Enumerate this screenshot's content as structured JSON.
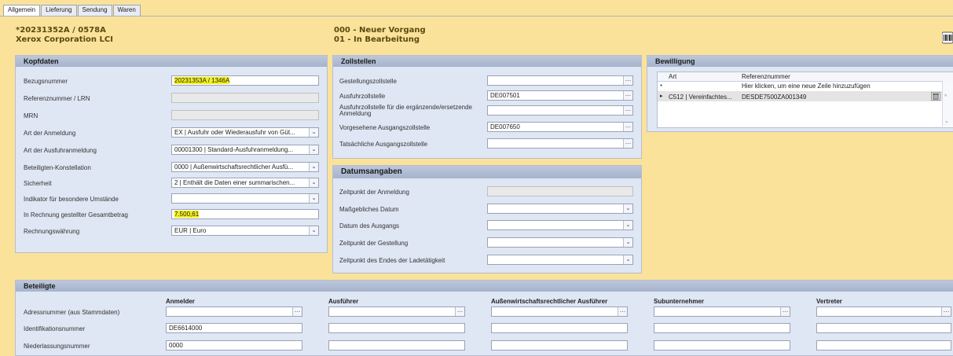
{
  "tabs": [
    "Allgemein",
    "Lieferung",
    "Sendung",
    "Waren"
  ],
  "header": {
    "left_line1": "*20231352A / 0578A",
    "left_line2": "Xerox Corporation LCI",
    "mid_line1": "000 - Neuer Vorgang",
    "mid_line2": "01 - In Bearbeitung"
  },
  "kopfdaten": {
    "title": "Kopfdaten",
    "fields": [
      {
        "label": "Bezugsnummer",
        "value": "20231353A / 1346A"
      },
      {
        "label": "Referenznummer / LRN",
        "value": ""
      },
      {
        "label": "MRN",
        "value": ""
      },
      {
        "label": "Art der Anmeldung",
        "value": "EX | Ausfuhr oder Wiederausfuhr von Güt..."
      },
      {
        "label": "Art der Ausfuhranmeldung",
        "value": "00001300 | Standard-Ausfuhranmeldung..."
      },
      {
        "label": "Beteiligten-Konstellation",
        "value": "0000 | Außenwirtschaftsrechtlicher Ausfü..."
      },
      {
        "label": "Sicherheit",
        "value": "2 | Enthält die Daten einer summarischen..."
      },
      {
        "label": "Indikator für besondere Umstände",
        "value": ""
      },
      {
        "label": "In Rechnung gestellter Gesamtbetrag",
        "value": "7.500,61"
      },
      {
        "label": "Rechnungswährung",
        "value": "EUR | Euro"
      }
    ]
  },
  "zollstellen": {
    "title": "Zollstellen",
    "fields": [
      {
        "label": "Gestellungszollstelle",
        "value": ""
      },
      {
        "label": "Ausfuhrzollstelle",
        "value": "DE007501"
      },
      {
        "label": "Ausfuhrzollstelle für die ergänzende/ersetzende Anmeldung",
        "value": ""
      },
      {
        "label": "Vorgesehene Ausgangszollstelle",
        "value": "DE007650"
      },
      {
        "label": "Tatsächliche Ausgangszollstelle",
        "value": ""
      }
    ]
  },
  "datumsangaben": {
    "title": "Datumsangaben",
    "fields": [
      {
        "label": "Zeitpunkt der Anmeldung",
        "value": ""
      },
      {
        "label": "Maßgebliches Datum",
        "value": ""
      },
      {
        "label": "Datum des Ausgangs",
        "value": ""
      },
      {
        "label": "Zeitpunkt der Gestellung",
        "value": ""
      },
      {
        "label": "Zeitpunkt des Endes der Ladetätigkeit",
        "value": ""
      }
    ]
  },
  "bewilligung": {
    "title": "Bewilligung",
    "col_art": "Art",
    "col_ref": "Referenznummer",
    "new_row_marker": "*",
    "new_row_hint": "Hier klicken, um eine neue Zeile hinzuzufügen",
    "row_marker": "▸",
    "row_art": "C512 | Vereinfachtes...",
    "row_ref": "DESDE7500ZA001349"
  },
  "beteiligte": {
    "title": "Beteiligte",
    "columns": [
      "Anmelder",
      "Ausführer",
      "Außenwirtschaftsrechtlicher Ausführer",
      "Subunternehmer",
      "Vertreter"
    ],
    "row_labels": [
      "Adressnummer (aus Stammdaten)",
      "Identifikationsnummer",
      "Niederlassungsnummer"
    ],
    "anmelder_id": "DE6614000",
    "anmelder_niederlassung": "0000"
  },
  "icons": {
    "dropdown": "chevron-down-icon",
    "lookup": "ellipsis-icon",
    "delete": "trash-icon",
    "barcode": "barcode-icon"
  },
  "colors": {
    "background": "#fbe29a",
    "panel": "#dfe6f4",
    "highlight": "#f4f01a"
  }
}
